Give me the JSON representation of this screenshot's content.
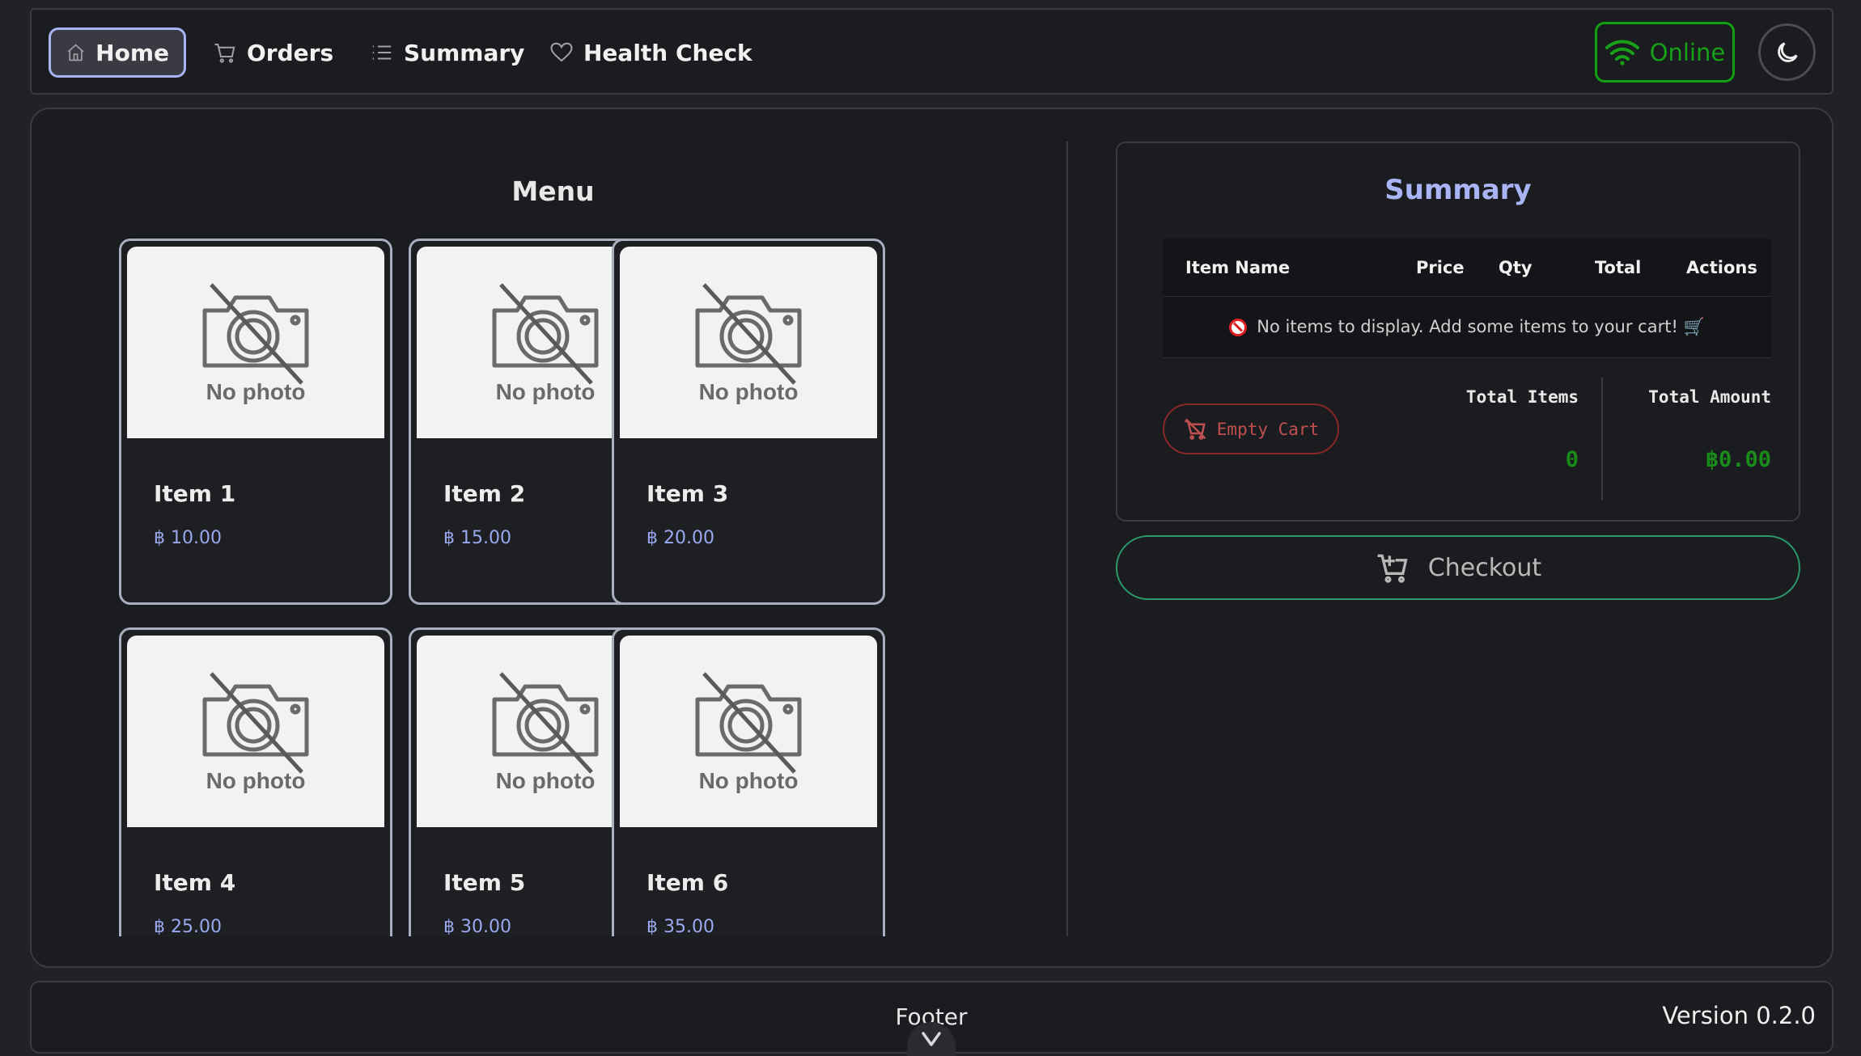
{
  "nav": {
    "items": [
      {
        "label": "Home",
        "icon": "home-icon",
        "active": true
      },
      {
        "label": "Orders",
        "icon": "cart-icon"
      },
      {
        "label": "Summary",
        "icon": "list-icon"
      },
      {
        "label": "Health Check",
        "icon": "heart-icon"
      }
    ],
    "status": {
      "label": "Online",
      "icon": "wifi-icon",
      "color": "#18a018"
    },
    "theme_toggle_icon": "moon-icon"
  },
  "menu": {
    "title": "Menu",
    "photo_placeholder": "No photo",
    "items": [
      {
        "name": "Item 1",
        "price": "฿ 10.00"
      },
      {
        "name": "Item 2",
        "price": "฿ 15.00"
      },
      {
        "name": "Item 3",
        "price": "฿ 20.00"
      },
      {
        "name": "Item 4",
        "price": "฿ 25.00"
      },
      {
        "name": "Item 5",
        "price": "฿ 30.00"
      },
      {
        "name": "Item 6",
        "price": "฿ 35.00"
      }
    ]
  },
  "summary": {
    "title": "Summary",
    "columns": [
      "Item Name",
      "Price",
      "Qty",
      "Total",
      "Actions"
    ],
    "empty_message": "No items to display. Add some items to your cart! 🛒",
    "empty_cart_label": "Empty Cart",
    "total_items_label": "Total Items",
    "total_items_value": "0",
    "total_amount_label": "Total Amount",
    "total_amount_value": "฿0.00"
  },
  "checkout": {
    "label": "Checkout"
  },
  "footer": {
    "label": "Footer",
    "version": "Version 0.2.0"
  },
  "colors": {
    "accent": "#a8b4f4",
    "online": "#18a018",
    "danger": "#c05050",
    "checkout_border": "#2a9a6a"
  }
}
